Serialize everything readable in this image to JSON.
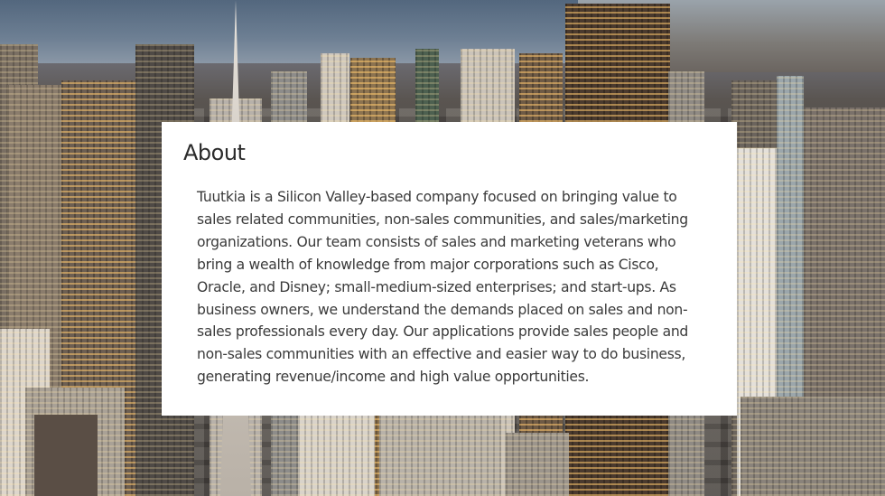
{
  "about": {
    "title": "About",
    "body": "Tuutkia is a Silicon Valley-based company focused on bringing value to sales related communities, non-sales communities, and sales/marketing organizations. Our team consists of sales and marketing veterans who bring a wealth of knowledge from major corporations such as Cisco, Oracle, and Disney; small-medium-sized enterprises; and start-ups. As business owners, we understand the demands placed on sales and non-sales professionals every day. Our applications provide sales people and non-sales communities with an effective and easier way to do business, generating revenue/income and high value opportunities."
  }
}
